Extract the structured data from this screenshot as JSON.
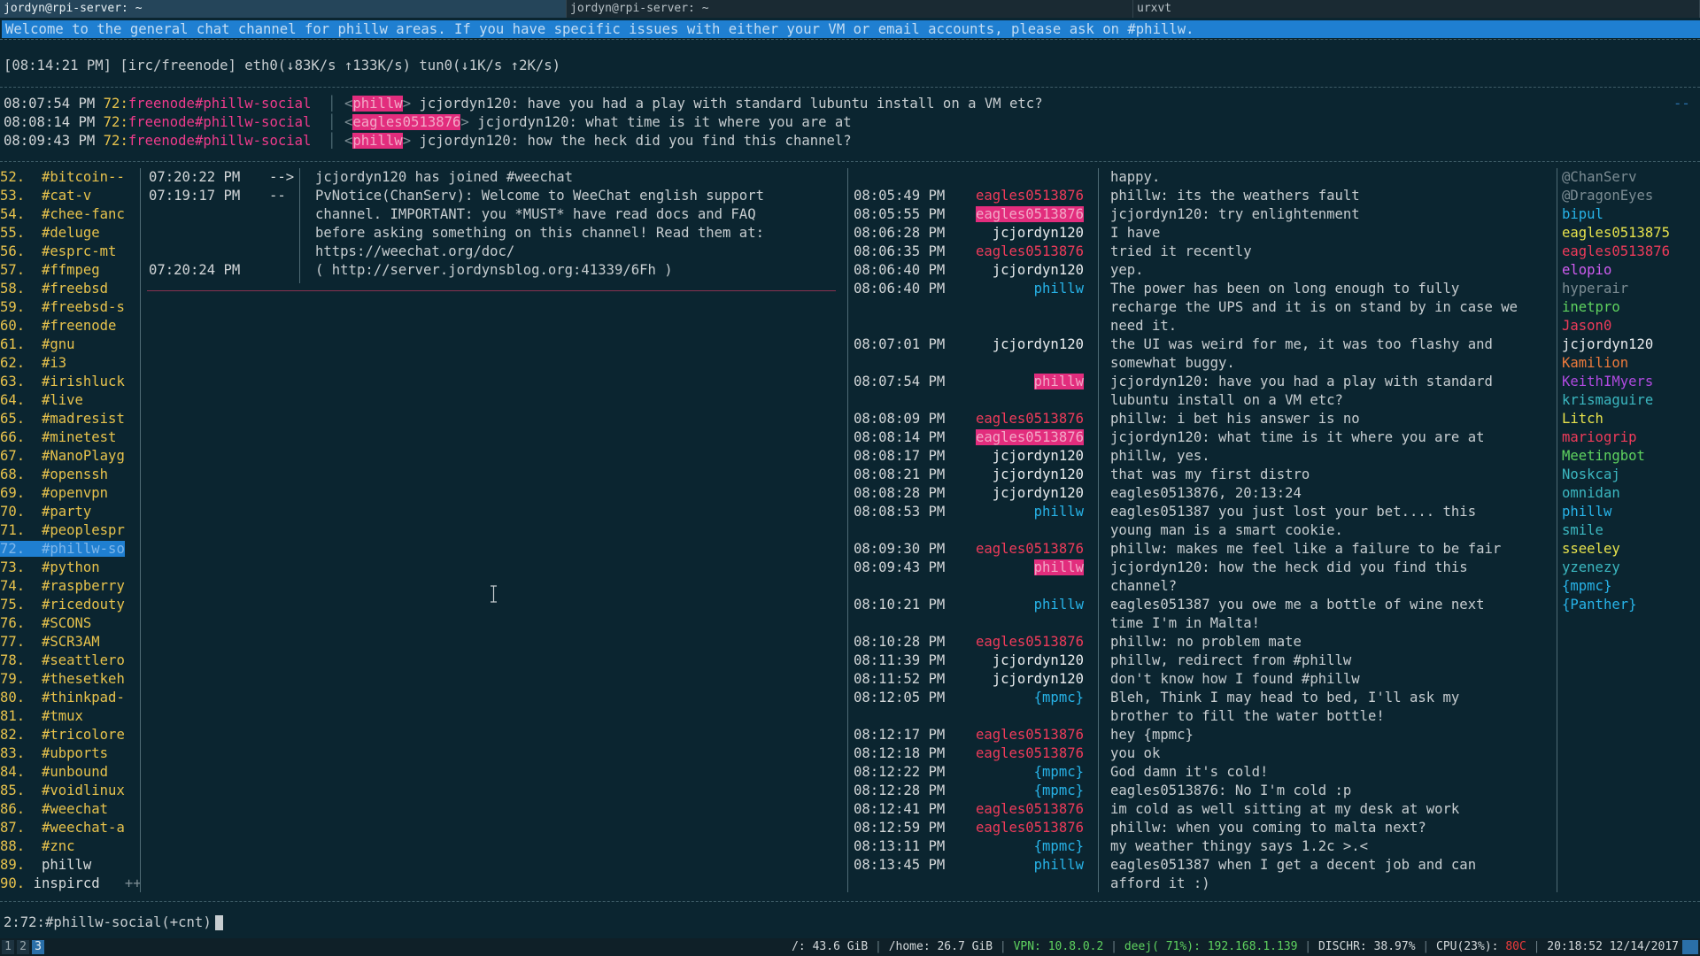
{
  "tabs": [
    "jordyn@rpi-server: ~",
    "jordyn@rpi-server: ~",
    "urxvt"
  ],
  "topic": "Welcome to the general chat channel  for phillw areas. If you have specific issues with either your VM or email accounts, please ask on #phillw.",
  "status": "[08:14:21 PM] [irc/freenode] eth0(↓83K/s ↑133K/s) tun0(↓1K/s ↑2K/s)",
  "highlights": [
    {
      "time": "08:07:54 PM",
      "num": "72",
      "buffer": "freenode#phillw-social",
      "nick": "phillw",
      "message": "jcjordyn120: have you had a play with standard lubuntu install on a VM etc?"
    },
    {
      "time": "08:08:14 PM",
      "num": "72",
      "buffer": "freenode#phillw-social",
      "nick": "eagles0513876",
      "message": "jcjordyn120: what time is it where you are at"
    },
    {
      "time": "08:09:43 PM",
      "num": "72",
      "buffer": "freenode#phillw-social",
      "nick": "phillw",
      "message": "jcjordyn120: how the heck did you find this channel?"
    }
  ],
  "highlight_more": "--",
  "channels": [
    {
      "idx": "52.",
      "name": "#bitcoin--"
    },
    {
      "idx": "53.",
      "name": "#cat-v"
    },
    {
      "idx": "54.",
      "name": "#chee-fanc"
    },
    {
      "idx": "55.",
      "name": "#deluge"
    },
    {
      "idx": "56.",
      "name": "#esprc-mt"
    },
    {
      "idx": "57.",
      "name": "#ffmpeg"
    },
    {
      "idx": "58.",
      "name": "#freebsd"
    },
    {
      "idx": "59.",
      "name": "#freebsd-s"
    },
    {
      "idx": "60.",
      "name": "#freenode"
    },
    {
      "idx": "61.",
      "name": "#gnu"
    },
    {
      "idx": "62.",
      "name": "#i3"
    },
    {
      "idx": "63.",
      "name": "#irishluck"
    },
    {
      "idx": "64.",
      "name": "#live"
    },
    {
      "idx": "65.",
      "name": "#madresist"
    },
    {
      "idx": "66.",
      "name": "#minetest"
    },
    {
      "idx": "67.",
      "name": "#NanoPlayg"
    },
    {
      "idx": "68.",
      "name": "#openssh"
    },
    {
      "idx": "69.",
      "name": "#openvpn"
    },
    {
      "idx": "70.",
      "name": "#party"
    },
    {
      "idx": "71.",
      "name": "#peoplespr"
    },
    {
      "idx": "72.",
      "name": "#phillw-so"
    },
    {
      "idx": "73.",
      "name": "#python"
    },
    {
      "idx": "74.",
      "name": "#raspberry"
    },
    {
      "idx": "75.",
      "name": "#ricedouty"
    },
    {
      "idx": "76.",
      "name": "#SCONS"
    },
    {
      "idx": "77.",
      "name": "#SCR3AM"
    },
    {
      "idx": "78.",
      "name": "#seattlero"
    },
    {
      "idx": "79.",
      "name": "#thesetkeh"
    },
    {
      "idx": "80.",
      "name": "#thinkpad-"
    },
    {
      "idx": "81.",
      "name": "#tmux"
    },
    {
      "idx": "82.",
      "name": "#tricolore"
    },
    {
      "idx": "83.",
      "name": "#ubports"
    },
    {
      "idx": "84.",
      "name": "#unbound"
    },
    {
      "idx": "85.",
      "name": "#voidlinux"
    },
    {
      "idx": "86.",
      "name": "#weechat"
    },
    {
      "idx": "87.",
      "name": "#weechat-a"
    },
    {
      "idx": "88.",
      "name": "#znc"
    },
    {
      "idx": "89.",
      "name": "phillw"
    },
    {
      "idx": "90.",
      "name": "inspircd"
    }
  ],
  "channels_more": "++",
  "weechat_buffer": [
    {
      "time": "07:20:22 PM",
      "prefix": "-->",
      "text": "jcjordyn120 has joined #weechat"
    },
    {
      "time": "07:19:17 PM",
      "prefix": "--",
      "text": "PvNotice(ChanServ): Welcome to WeeChat english support"
    },
    {
      "time": "",
      "prefix": "",
      "text": "channel. IMPORTANT: you *MUST* have read docs and FAQ"
    },
    {
      "time": "",
      "prefix": "",
      "text": "before asking something on this channel! Read them at:"
    },
    {
      "time": "",
      "prefix": "",
      "text": "https://weechat.org/doc/"
    },
    {
      "time": "07:20:24 PM",
      "prefix": "",
      "text": "( http://server.jordynsblog.org:41339/6Fh )"
    }
  ],
  "chat": [
    {
      "time": "",
      "nick": "",
      "nickclass": "",
      "message": "happy.",
      "row": 0
    },
    {
      "time": "08:05:49 PM",
      "nick": "eagles0513876",
      "nickclass": "n-eagles",
      "message": "phillw: its the weathers fault",
      "row": 1
    },
    {
      "time": "08:05:55 PM",
      "nick": "eagles0513876",
      "nickclass": "nickhl",
      "message": "jcjordyn120: try enlightenment",
      "row": 2
    },
    {
      "time": "08:06:28 PM",
      "nick": "jcjordyn120",
      "nickclass": "n-jc",
      "message": "I have",
      "row": 3
    },
    {
      "time": "08:06:35 PM",
      "nick": "eagles0513876",
      "nickclass": "n-eagles",
      "message": "tried it recently",
      "row": 4
    },
    {
      "time": "08:06:40 PM",
      "nick": "jcjordyn120",
      "nickclass": "n-jc",
      "message": "yep.",
      "row": 5
    },
    {
      "time": "08:06:40 PM",
      "nick": "phillw",
      "nickclass": "n-phillw",
      "message": "The power has been on long enough to fully",
      "row": 6
    },
    {
      "time": "",
      "nick": "",
      "nickclass": "",
      "message": "recharge the UPS and it is on stand by in case we",
      "row": 7
    },
    {
      "time": "",
      "nick": "",
      "nickclass": "",
      "message": "need it.",
      "row": 8
    },
    {
      "time": "08:07:01 PM",
      "nick": "jcjordyn120",
      "nickclass": "n-jc",
      "message": "the UI was weird for me, it was too flashy and",
      "row": 9
    },
    {
      "time": "",
      "nick": "",
      "nickclass": "",
      "message": "somewhat buggy.",
      "row": 10
    },
    {
      "time": "08:07:54 PM",
      "nick": "phillw",
      "nickclass": "nickhl",
      "message": "jcjordyn120: have you had a play with standard",
      "row": 11
    },
    {
      "time": "",
      "nick": "",
      "nickclass": "",
      "message": "lubuntu install on a VM etc?",
      "row": 12
    },
    {
      "time": "08:08:09 PM",
      "nick": "eagles0513876",
      "nickclass": "n-eagles",
      "message": "phillw: i bet his answer is no",
      "row": 13
    },
    {
      "time": "08:08:14 PM",
      "nick": "eagles0513876",
      "nickclass": "nickhl",
      "message": "jcjordyn120: what time is it where you are at",
      "row": 14
    },
    {
      "time": "08:08:17 PM",
      "nick": "jcjordyn120",
      "nickclass": "n-jc",
      "message": "phillw, yes.",
      "row": 15
    },
    {
      "time": "08:08:21 PM",
      "nick": "jcjordyn120",
      "nickclass": "n-jc",
      "message": "that was my first distro",
      "row": 16
    },
    {
      "time": "08:08:28 PM",
      "nick": "jcjordyn120",
      "nickclass": "n-jc",
      "message": "eagles0513876, 20:13:24",
      "row": 17
    },
    {
      "time": "08:08:53 PM",
      "nick": "phillw",
      "nickclass": "n-phillw",
      "message": "eagles051387 you just lost your bet.... this",
      "row": 18
    },
    {
      "time": "",
      "nick": "",
      "nickclass": "",
      "message": "young man is a smart cookie.",
      "row": 19
    },
    {
      "time": "08:09:30 PM",
      "nick": "eagles0513876",
      "nickclass": "n-eagles",
      "message": "phillw: makes me feel like a failure to be fair",
      "row": 20
    },
    {
      "time": "08:09:43 PM",
      "nick": "phillw",
      "nickclass": "nickhl",
      "message": "jcjordyn120: how the heck did you find this",
      "row": 21
    },
    {
      "time": "",
      "nick": "",
      "nickclass": "",
      "message": "channel?",
      "row": 22
    },
    {
      "time": "08:10:21 PM",
      "nick": "phillw",
      "nickclass": "n-phillw",
      "message": "eagles051387 you owe me a bottle of wine next",
      "row": 23
    },
    {
      "time": "",
      "nick": "",
      "nickclass": "",
      "message": "time I'm in Malta!",
      "row": 24
    },
    {
      "time": "08:10:28 PM",
      "nick": "eagles0513876",
      "nickclass": "n-eagles",
      "message": "phillw: no problem mate",
      "row": 25
    },
    {
      "time": "08:11:39 PM",
      "nick": "jcjordyn120",
      "nickclass": "n-jc",
      "message": "phillw, redirect from #phillw",
      "row": 26
    },
    {
      "time": "08:11:52 PM",
      "nick": "jcjordyn120",
      "nickclass": "n-jc",
      "message": "don't know how I found #phillw",
      "row": 27
    },
    {
      "time": "08:12:05 PM",
      "nick": "{mpmc}",
      "nickclass": "n-mpmc",
      "message": "Bleh, Think I may head to bed, I'll ask my",
      "row": 28
    },
    {
      "time": "",
      "nick": "",
      "nickclass": "",
      "message": "brother to fill the water bottle!",
      "row": 29
    },
    {
      "time": "08:12:17 PM",
      "nick": "eagles0513876",
      "nickclass": "n-eagles",
      "message": "hey {mpmc}",
      "row": 30
    },
    {
      "time": "08:12:18 PM",
      "nick": "eagles0513876",
      "nickclass": "n-eagles",
      "message": "you ok",
      "row": 31
    },
    {
      "time": "08:12:22 PM",
      "nick": "{mpmc}",
      "nickclass": "n-mpmc",
      "message": "God damn it's cold!",
      "row": 32
    },
    {
      "time": "08:12:28 PM",
      "nick": "{mpmc}",
      "nickclass": "n-mpmc",
      "message": "eagles0513876: No I'm cold :p",
      "row": 33
    },
    {
      "time": "08:12:41 PM",
      "nick": "eagles0513876",
      "nickclass": "n-eagles",
      "message": "im cold as well sitting at my desk at work",
      "row": 34
    },
    {
      "time": "08:12:59 PM",
      "nick": "eagles0513876",
      "nickclass": "n-eagles",
      "message": "phillw: when you coming to malta next?",
      "row": 35
    },
    {
      "time": "08:13:11 PM",
      "nick": "{mpmc}",
      "nickclass": "n-mpmc",
      "message": "my weather thingy says 1.2c >.<",
      "row": 36
    },
    {
      "time": "08:13:45 PM",
      "nick": "phillw",
      "nickclass": "n-phillw",
      "message": "eagles051387 when I get a decent job and can",
      "row": 37
    },
    {
      "time": "",
      "nick": "",
      "nickclass": "",
      "message": "afford it :)",
      "row": 38
    }
  ],
  "nicklist": [
    {
      "name": "@ChanServ",
      "color": "#7c8c93"
    },
    {
      "name": "@DragonEyes",
      "color": "#7c8c93"
    },
    {
      "name": "bipul",
      "color": "#27b3e8"
    },
    {
      "name": "eagles0513875",
      "color": "#e7e24c"
    },
    {
      "name": "eagles0513876",
      "color": "#ee3b5a"
    },
    {
      "name": "elopio",
      "color": "#d05cf0"
    },
    {
      "name": "hyperair",
      "color": "#7c8c93"
    },
    {
      "name": "inetpro",
      "color": "#5fd35f"
    },
    {
      "name": "Jason0",
      "color": "#ee3b5a"
    },
    {
      "name": "jcjordyn120",
      "color": "#e9ecee"
    },
    {
      "name": "Kamilion",
      "color": "#ee7a3b"
    },
    {
      "name": "KeithIMyers",
      "color": "#b04ae0"
    },
    {
      "name": "krismaguire",
      "color": "#3bb7c0"
    },
    {
      "name": "Litch",
      "color": "#e7e24c"
    },
    {
      "name": "mariogrip",
      "color": "#ee3b5a"
    },
    {
      "name": "Meetingbot",
      "color": "#5fd35f"
    },
    {
      "name": "Noskcaj",
      "color": "#3bb7c0"
    },
    {
      "name": "omnidan",
      "color": "#3bb7c0"
    },
    {
      "name": "phillw",
      "color": "#27b3e8"
    },
    {
      "name": "smile",
      "color": "#3bb7c0"
    },
    {
      "name": "sseeley",
      "color": "#e7e24c"
    },
    {
      "name": "yzenezy",
      "color": "#3bb7c0"
    },
    {
      "name": "{mpmc}",
      "color": "#27b3e8"
    },
    {
      "name": "{Panther}",
      "color": "#27b3e8"
    }
  ],
  "input_prompt": "2:72:#phillw-social(+cnt)",
  "workspaces": [
    "1",
    "2",
    "3"
  ],
  "sysinfo": {
    "root": "/: 43.6 GiB",
    "home": "/home: 26.7 GiB",
    "vpn": "VPN: 10.8.0.2",
    "wifi": "deej( 71%): 192.168.1.139",
    "battery": "DISCHR: 38.97%",
    "cpu": "CPU(23%):",
    "temp": "80C",
    "datetime": "20:18:52 12/14/2017"
  }
}
